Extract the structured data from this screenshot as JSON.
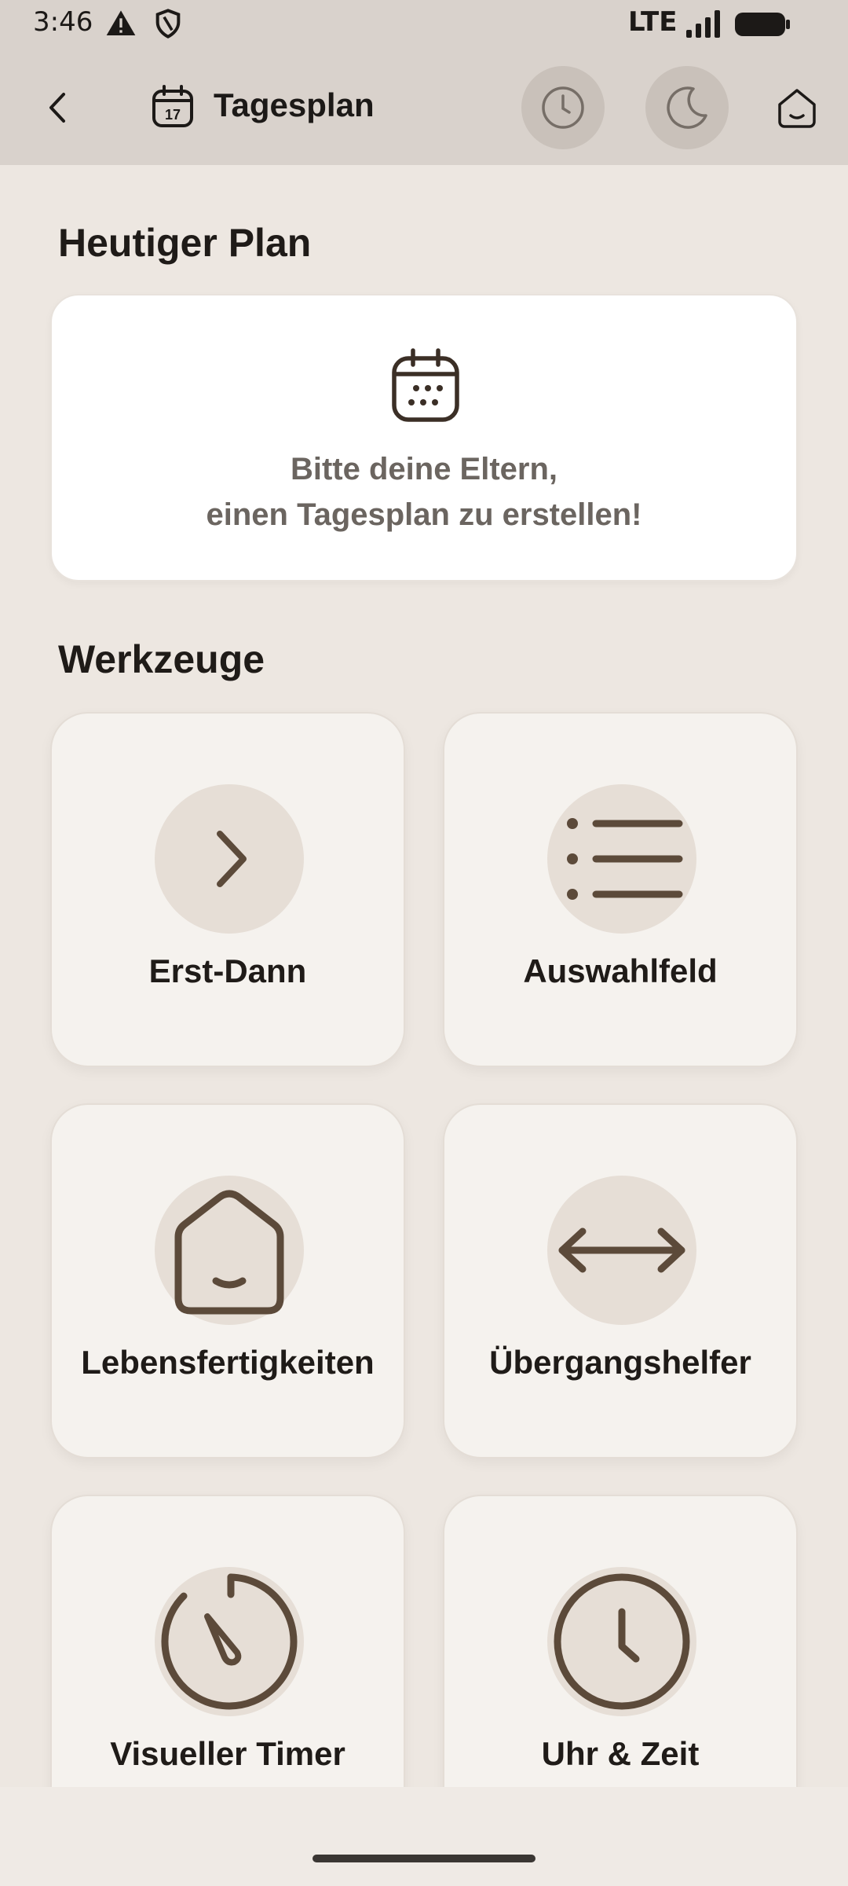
{
  "status_bar": {
    "time": "3:46",
    "network": "LTE"
  },
  "app_bar": {
    "title": "Tagesplan",
    "calendar_day": "17"
  },
  "sections": {
    "plan_title": "Heutiger Plan",
    "tools_title": "Werkzeuge"
  },
  "plan_card": {
    "line1": "Bitte deine Eltern,",
    "line2": "einen Tagesplan zu erstellen!"
  },
  "tools": [
    {
      "label": "Erst-Dann",
      "icon": "chevron-right-icon"
    },
    {
      "label": "Auswahlfeld",
      "icon": "list-icon"
    },
    {
      "label": "Lebensfertigkeiten",
      "icon": "home-smile-icon"
    },
    {
      "label": "Übergangshelfer",
      "icon": "arrows-horizontal-icon"
    },
    {
      "label": "Visueller Timer",
      "icon": "timer-icon"
    },
    {
      "label": "Uhr & Zeit",
      "icon": "clock-icon"
    }
  ],
  "colors": {
    "accent": "#5c4a3a",
    "background": "#ede7e1",
    "card": "#f5f2ee",
    "app_bar": "#d9d2cc"
  }
}
